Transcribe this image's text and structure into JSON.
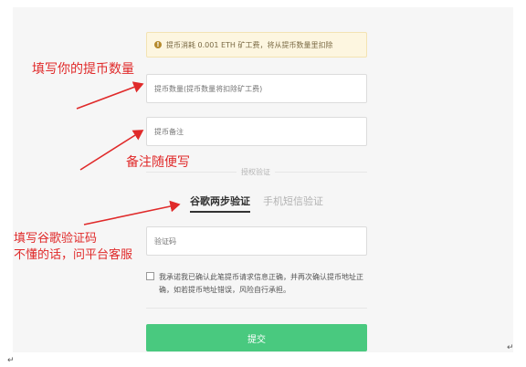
{
  "notice": {
    "icon": "warning-circle-icon",
    "text": "提币消耗 0.001 ETH 矿工费，将从提币数量里扣除"
  },
  "form": {
    "amount_placeholder": "提币数量(提币数量将扣除矿工费)",
    "memo_placeholder": "提币备注",
    "divider_label": "授权验证",
    "tabs": [
      {
        "label": "谷歌两步验证",
        "active": true
      },
      {
        "label": "手机短信验证",
        "active": false
      }
    ],
    "code_placeholder": "验证码",
    "agreement_text": "我承诺我已确认此笔提币请求信息正确，并再次确认提币地址正确，如若提币地址错误，风险自行承担。",
    "submit_label": "提交"
  },
  "annotations": {
    "amount_note": "填写你的提币数量",
    "memo_note": "备注随便写",
    "google_note_line1": "填写谷歌验证码",
    "google_note_line2": "不懂的话，问平台客服"
  },
  "doc_marks": {
    "return_mark": "↵"
  },
  "colors": {
    "accent": "#49c97f",
    "annotation": "#e02a2a",
    "notice_bg": "#fdf6e0"
  }
}
